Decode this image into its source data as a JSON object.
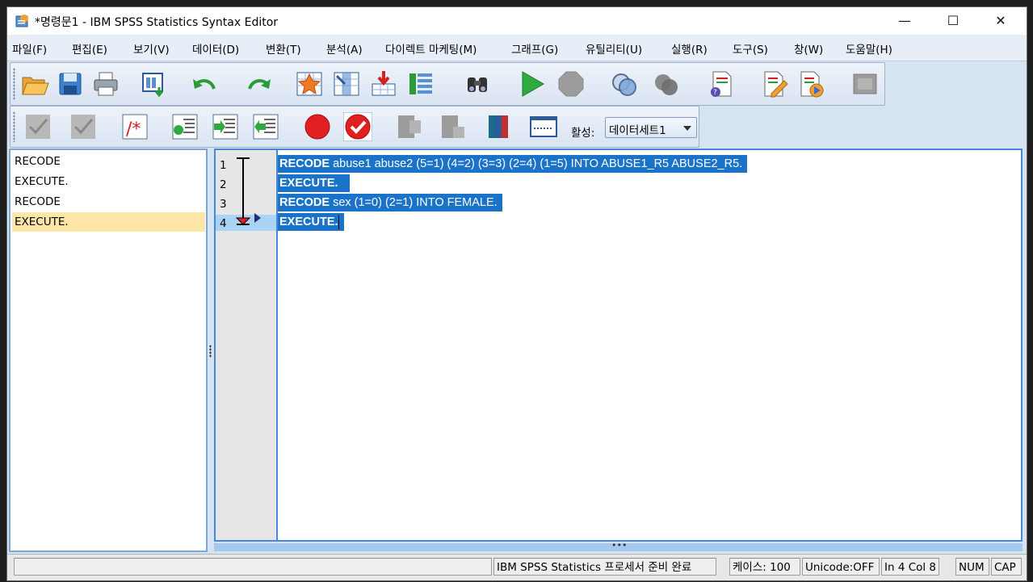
{
  "window": {
    "title": "*명령문1 - IBM SPSS Statistics Syntax Editor",
    "controls": {
      "minimize": "—",
      "maximize": "☐",
      "close": "✕"
    }
  },
  "menubar": [
    "파일(F)",
    "편집(E)",
    "보기(V)",
    "데이터(D)",
    "변환(T)",
    "분석(A)",
    "다이렉트 마케팅(M)",
    "그래프(G)",
    "유틸리티(U)",
    "실행(R)",
    "도구(S)",
    "창(W)",
    "도움말(H)"
  ],
  "toolbar1": {
    "icons": [
      "open-icon",
      "save-icon",
      "print-icon",
      "recall-dialog-icon",
      "undo-icon",
      "redo-icon",
      "goto-case-icon",
      "goto-variable-icon",
      "variables-icon",
      "value-labels-icon",
      "find-icon",
      "run-icon",
      "stop-icon",
      "use-sets-icon",
      "show-all-vars-icon",
      "syntax-help-icon",
      "edit-icon",
      "run-script-icon",
      "designate-window-icon"
    ]
  },
  "toolbar2": {
    "active_label": "활성:",
    "dataset_value": "데이터세트1"
  },
  "navigator": {
    "items": [
      {
        "label": "RECODE",
        "selected": false
      },
      {
        "label": "EXECUTE.",
        "selected": false
      },
      {
        "label": "RECODE",
        "selected": false
      },
      {
        "label": "EXECUTE.",
        "selected": true
      }
    ]
  },
  "editor": {
    "line_numbers": [
      "1",
      "2",
      "3",
      "4"
    ],
    "current_line": "4",
    "lines": [
      {
        "kw": "RECODE",
        "rest": " abuse1 abuse2 (5=1) (4=2) (3=3) (2=4) (1=5) INTO ABUSE1_R5 ABUSE2_R5."
      },
      {
        "kw": "EXECUTE.",
        "rest": ""
      },
      {
        "kw": "RECODE",
        "rest": " sex (1=0) (2=1) INTO FEMALE."
      },
      {
        "kw": "EXECUTE.",
        "rest": ""
      }
    ],
    "hscroll_grip": "•••"
  },
  "statusbar": {
    "processor": "IBM SPSS Statistics 프로세서 준비 완료",
    "cases": "케이스: 100",
    "unicode": "Unicode:OFF",
    "position": "In 4 Col 8",
    "num": "NUM",
    "cap": "CAP"
  },
  "colors": {
    "selection": "#1b73c9",
    "nav_selected": "#fce7a8",
    "chrome": "#d6e3f1"
  }
}
